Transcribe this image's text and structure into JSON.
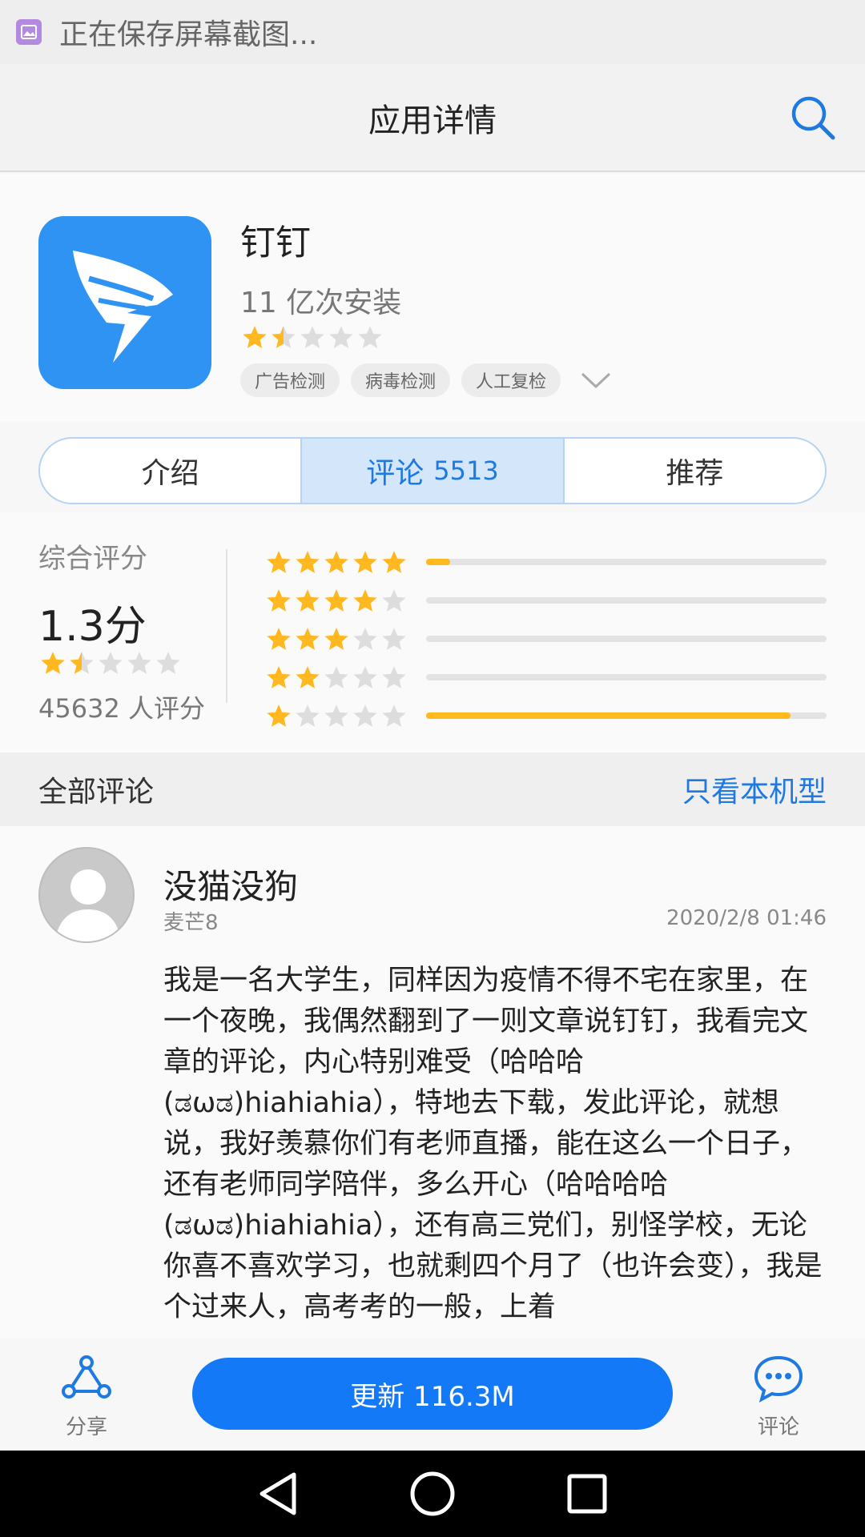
{
  "status_bar": {
    "text": "正在保存屏幕截图..."
  },
  "app_bar": {
    "title": "应用详情",
    "search_icon": "search-icon"
  },
  "app": {
    "name": "钉钉",
    "installs": "11 亿次安装",
    "rating": 1.5,
    "tags": [
      "广告检测",
      "病毒检测",
      "人工复检"
    ]
  },
  "tabs": [
    {
      "label": "介绍",
      "count": ""
    },
    {
      "label": "评论",
      "count": "5513"
    },
    {
      "label": "推荐",
      "count": ""
    }
  ],
  "rating": {
    "label": "综合评分",
    "score": "1.3分",
    "stars": 1.5,
    "count": "45632 人评分",
    "distribution": [
      {
        "stars": 5,
        "fraction": 0.06
      },
      {
        "stars": 4,
        "fraction": 0.0
      },
      {
        "stars": 3,
        "fraction": 0.0
      },
      {
        "stars": 2,
        "fraction": 0.0
      },
      {
        "stars": 1,
        "fraction": 0.91
      }
    ]
  },
  "reviews_section": {
    "title": "全部评论",
    "filter_link": "只看本机型"
  },
  "review": {
    "user": "没猫没狗",
    "device": "麦芒8",
    "date": "2020/2/8 01:46",
    "text": "我是一名大学生，同样因为疫情不得不宅在家里，在一个夜晚，我偶然翻到了一则文章说钉钉，我看完文章的评论，内心特别难受（哈哈哈(ಡωಡ)hiahiahia），特地去下载，发此评论，就想说，我好羡慕你们有老师直播，能在这么一个日子，还有老师同学陪伴，多么开心（哈哈哈哈(ಡωಡ)hiahiahia），还有高三党们，别怪学校，无论你喜不喜欢学习，也就剩四个月了（也许会变），我是个过来人，高考考的一般，上着"
  },
  "bottom_bar": {
    "share_label": "分享",
    "update_label": "更新 116.3M",
    "comment_label": "评论"
  },
  "colors": {
    "accent": "#1479f6",
    "star": "#ffb81f",
    "star_empty": "#dddddd",
    "tab_active_bg": "#d3e6fa"
  }
}
